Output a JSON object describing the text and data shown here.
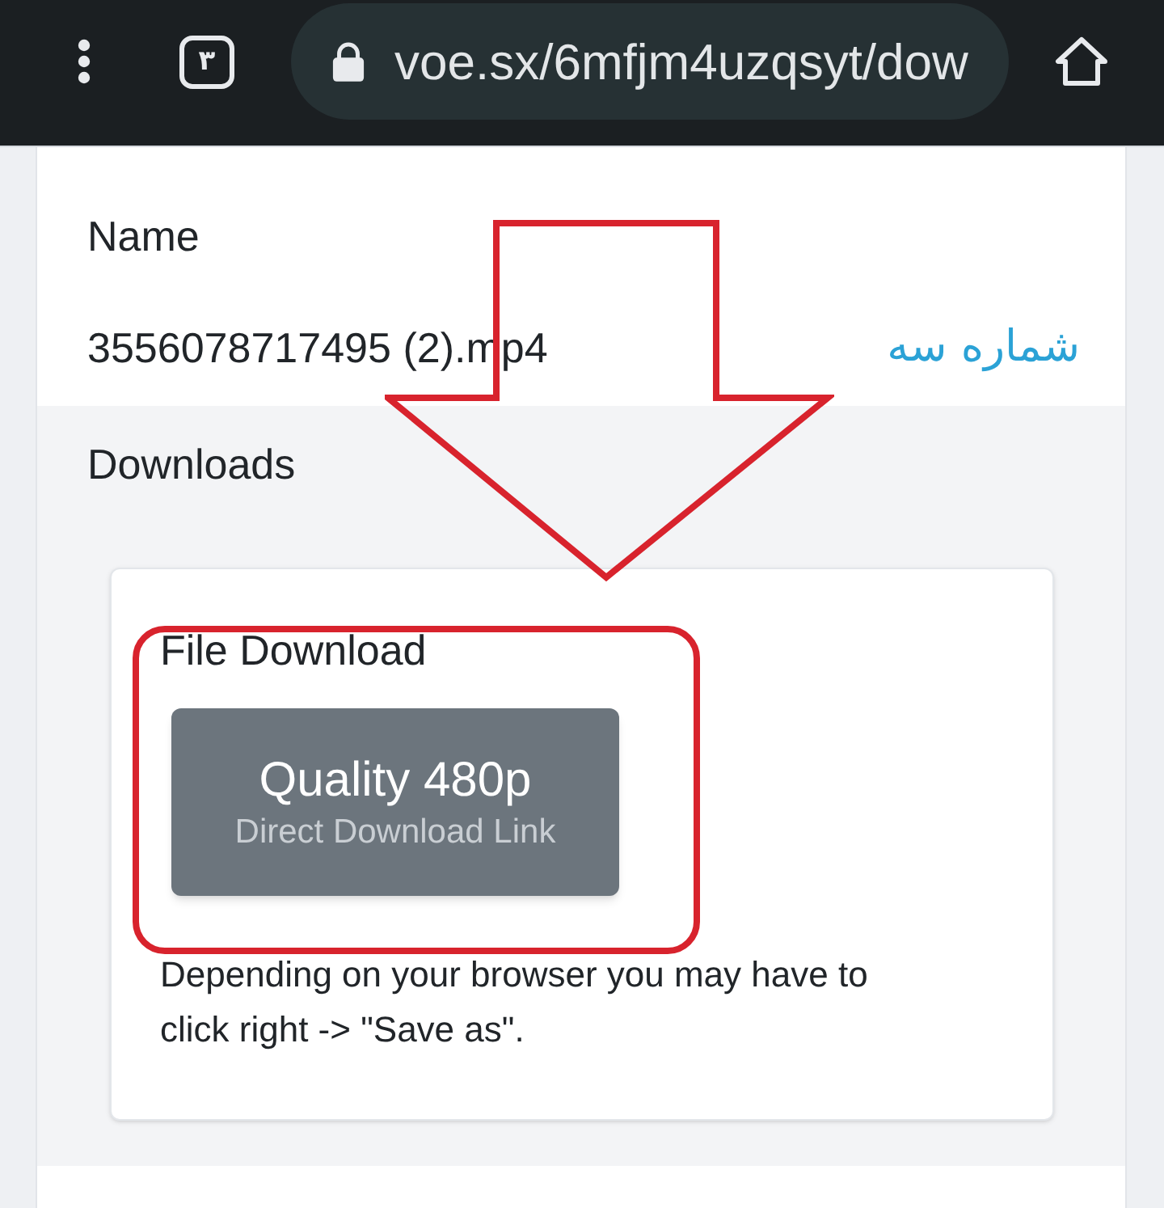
{
  "toolbar": {
    "tab_count": "۳",
    "url": "voe.sx/6mfjm4uzqsyt/dow",
    "secure": true
  },
  "file": {
    "label": "Name",
    "value": "3556078717495 (2).mp4"
  },
  "downloads": {
    "heading": "Downloads",
    "card": {
      "title": "File Download",
      "buttons": [
        {
          "quality": "Quality 480p",
          "subtitle": "Direct Download Link"
        }
      ],
      "note": "Depending on your browser you may have to click right -> \"Save as\"."
    }
  },
  "annotations": {
    "label": "شماره سه"
  }
}
